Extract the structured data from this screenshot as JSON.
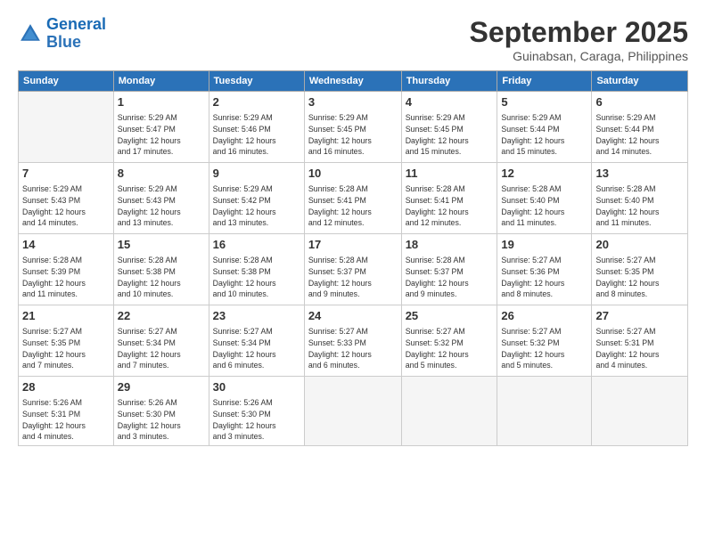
{
  "logo": {
    "line1": "General",
    "line2": "Blue"
  },
  "title": "September 2025",
  "subtitle": "Guinabsan, Caraga, Philippines",
  "days_header": [
    "Sunday",
    "Monday",
    "Tuesday",
    "Wednesday",
    "Thursday",
    "Friday",
    "Saturday"
  ],
  "weeks": [
    [
      {
        "day": "",
        "text": ""
      },
      {
        "day": "1",
        "text": "Sunrise: 5:29 AM\nSunset: 5:47 PM\nDaylight: 12 hours\nand 17 minutes."
      },
      {
        "day": "2",
        "text": "Sunrise: 5:29 AM\nSunset: 5:46 PM\nDaylight: 12 hours\nand 16 minutes."
      },
      {
        "day": "3",
        "text": "Sunrise: 5:29 AM\nSunset: 5:45 PM\nDaylight: 12 hours\nand 16 minutes."
      },
      {
        "day": "4",
        "text": "Sunrise: 5:29 AM\nSunset: 5:45 PM\nDaylight: 12 hours\nand 15 minutes."
      },
      {
        "day": "5",
        "text": "Sunrise: 5:29 AM\nSunset: 5:44 PM\nDaylight: 12 hours\nand 15 minutes."
      },
      {
        "day": "6",
        "text": "Sunrise: 5:29 AM\nSunset: 5:44 PM\nDaylight: 12 hours\nand 14 minutes."
      }
    ],
    [
      {
        "day": "7",
        "text": "Sunrise: 5:29 AM\nSunset: 5:43 PM\nDaylight: 12 hours\nand 14 minutes."
      },
      {
        "day": "8",
        "text": "Sunrise: 5:29 AM\nSunset: 5:43 PM\nDaylight: 12 hours\nand 13 minutes."
      },
      {
        "day": "9",
        "text": "Sunrise: 5:29 AM\nSunset: 5:42 PM\nDaylight: 12 hours\nand 13 minutes."
      },
      {
        "day": "10",
        "text": "Sunrise: 5:28 AM\nSunset: 5:41 PM\nDaylight: 12 hours\nand 12 minutes."
      },
      {
        "day": "11",
        "text": "Sunrise: 5:28 AM\nSunset: 5:41 PM\nDaylight: 12 hours\nand 12 minutes."
      },
      {
        "day": "12",
        "text": "Sunrise: 5:28 AM\nSunset: 5:40 PM\nDaylight: 12 hours\nand 11 minutes."
      },
      {
        "day": "13",
        "text": "Sunrise: 5:28 AM\nSunset: 5:40 PM\nDaylight: 12 hours\nand 11 minutes."
      }
    ],
    [
      {
        "day": "14",
        "text": "Sunrise: 5:28 AM\nSunset: 5:39 PM\nDaylight: 12 hours\nand 11 minutes."
      },
      {
        "day": "15",
        "text": "Sunrise: 5:28 AM\nSunset: 5:38 PM\nDaylight: 12 hours\nand 10 minutes."
      },
      {
        "day": "16",
        "text": "Sunrise: 5:28 AM\nSunset: 5:38 PM\nDaylight: 12 hours\nand 10 minutes."
      },
      {
        "day": "17",
        "text": "Sunrise: 5:28 AM\nSunset: 5:37 PM\nDaylight: 12 hours\nand 9 minutes."
      },
      {
        "day": "18",
        "text": "Sunrise: 5:28 AM\nSunset: 5:37 PM\nDaylight: 12 hours\nand 9 minutes."
      },
      {
        "day": "19",
        "text": "Sunrise: 5:27 AM\nSunset: 5:36 PM\nDaylight: 12 hours\nand 8 minutes."
      },
      {
        "day": "20",
        "text": "Sunrise: 5:27 AM\nSunset: 5:35 PM\nDaylight: 12 hours\nand 8 minutes."
      }
    ],
    [
      {
        "day": "21",
        "text": "Sunrise: 5:27 AM\nSunset: 5:35 PM\nDaylight: 12 hours\nand 7 minutes."
      },
      {
        "day": "22",
        "text": "Sunrise: 5:27 AM\nSunset: 5:34 PM\nDaylight: 12 hours\nand 7 minutes."
      },
      {
        "day": "23",
        "text": "Sunrise: 5:27 AM\nSunset: 5:34 PM\nDaylight: 12 hours\nand 6 minutes."
      },
      {
        "day": "24",
        "text": "Sunrise: 5:27 AM\nSunset: 5:33 PM\nDaylight: 12 hours\nand 6 minutes."
      },
      {
        "day": "25",
        "text": "Sunrise: 5:27 AM\nSunset: 5:32 PM\nDaylight: 12 hours\nand 5 minutes."
      },
      {
        "day": "26",
        "text": "Sunrise: 5:27 AM\nSunset: 5:32 PM\nDaylight: 12 hours\nand 5 minutes."
      },
      {
        "day": "27",
        "text": "Sunrise: 5:27 AM\nSunset: 5:31 PM\nDaylight: 12 hours\nand 4 minutes."
      }
    ],
    [
      {
        "day": "28",
        "text": "Sunrise: 5:26 AM\nSunset: 5:31 PM\nDaylight: 12 hours\nand 4 minutes."
      },
      {
        "day": "29",
        "text": "Sunrise: 5:26 AM\nSunset: 5:30 PM\nDaylight: 12 hours\nand 3 minutes."
      },
      {
        "day": "30",
        "text": "Sunrise: 5:26 AM\nSunset: 5:30 PM\nDaylight: 12 hours\nand 3 minutes."
      },
      {
        "day": "",
        "text": ""
      },
      {
        "day": "",
        "text": ""
      },
      {
        "day": "",
        "text": ""
      },
      {
        "day": "",
        "text": ""
      }
    ]
  ]
}
